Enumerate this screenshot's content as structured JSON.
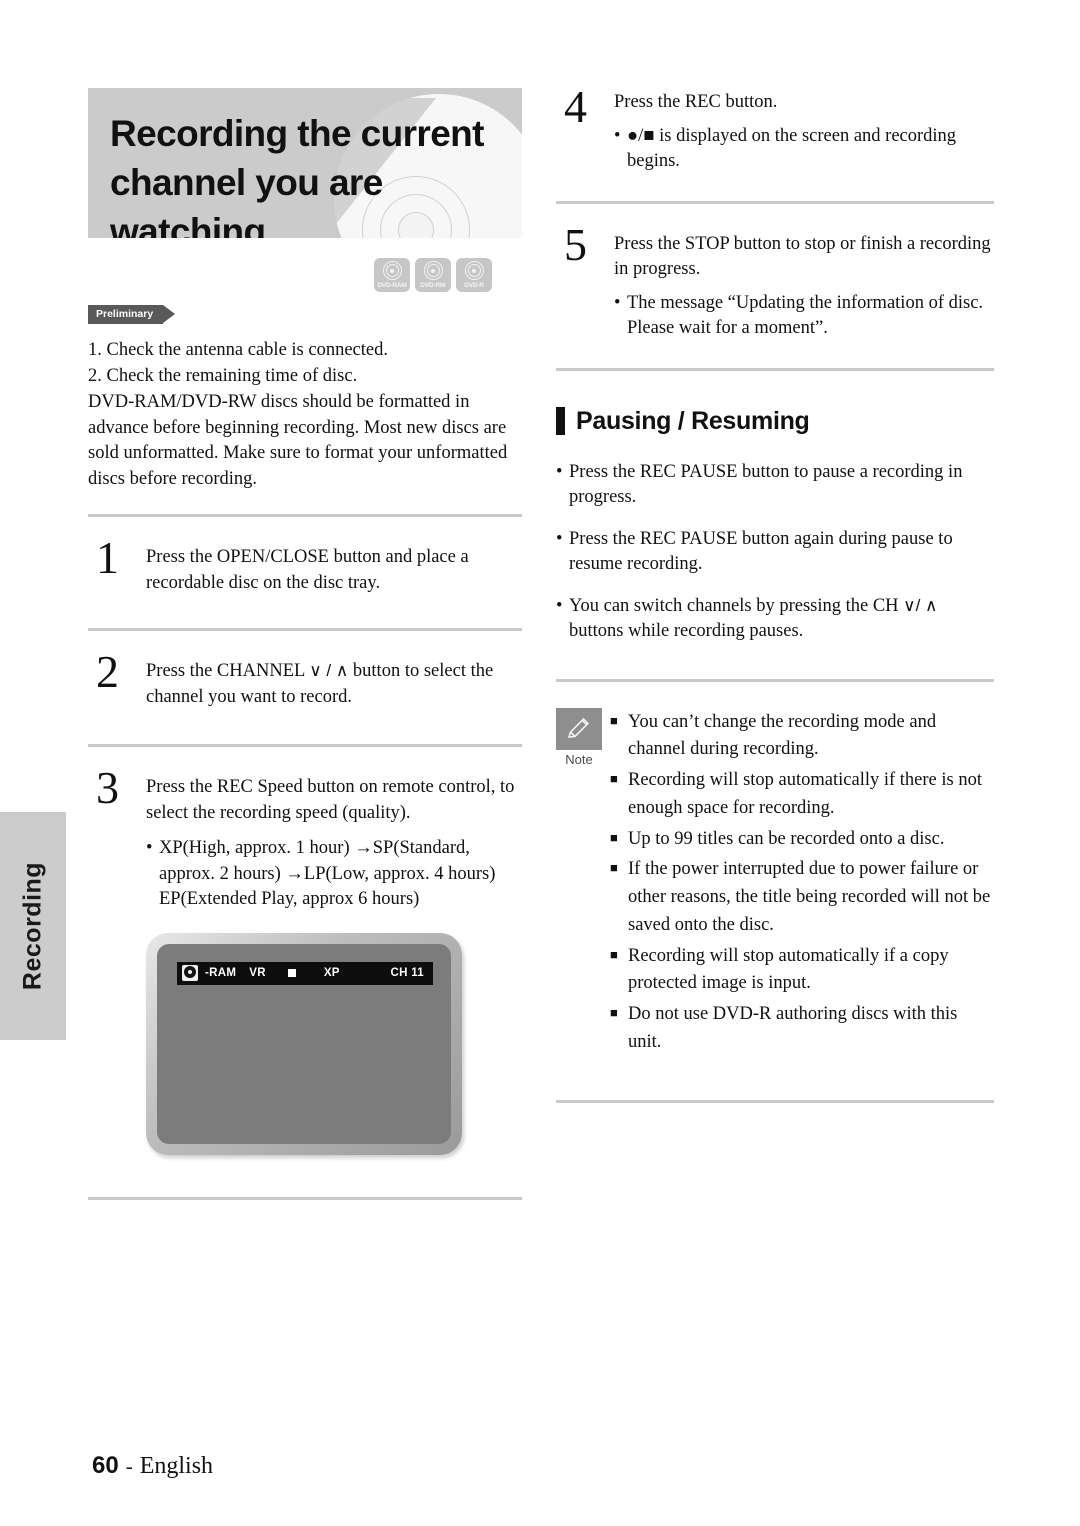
{
  "side_tab": {
    "label": "Recording"
  },
  "banner": {
    "title_line1": "Recording the current",
    "title_line2": "channel you are watching"
  },
  "disc_badges": [
    {
      "label": "DVD-RAM",
      "icon": "disc-icon"
    },
    {
      "label": "DVD-RW",
      "icon": "disc-icon"
    },
    {
      "label": "DVD-R",
      "icon": "disc-icon"
    }
  ],
  "preliminary_flag": {
    "label": "Preliminary"
  },
  "intro": {
    "line1": "1. Check the antenna cable is connected.",
    "line2": "2. Check the remaining time of disc.",
    "paragraph": "DVD-RAM/DVD-RW discs should be formatted in advance before beginning recording. Most new discs are sold unformatted. Make sure to format your unformatted discs before recording."
  },
  "steps": [
    {
      "number": "1",
      "text": "Press the OPEN/CLOSE button and place a recordable disc on the disc tray.",
      "bullets": []
    },
    {
      "number": "2",
      "text_before": "Press the CHANNEL ",
      "arrows": "∨ / ∧",
      "text_after": " button to select the channel you want to record.",
      "bullets": []
    },
    {
      "number": "3",
      "text": "Press the REC Speed button on remote control, to select the recording speed (quality).",
      "bullets": [
        "XP(High, approx. 1 hour) →SP(Standard, approx. 2 hours) →LP(Low, approx. 4 hours) EP(Extended Play, approx 6 hours)"
      ]
    },
    {
      "number": "4",
      "text": "Press the REC button.",
      "bullets": [
        "●/■ is displayed on the screen and recording begins."
      ]
    },
    {
      "number": "5",
      "text": "Press the STOP button to stop or finish a recording in progress.",
      "bullets": [
        "The message “Updating  the information of disc. Please wait for a moment”."
      ]
    }
  ],
  "tv_figure": {
    "osd": {
      "disc_icon": "dvd-ram-disc-icon",
      "disc_type": "-RAM",
      "format": "VR",
      "status_icon": "stop-square-icon",
      "rec_speed": "XP",
      "channel": "CH 11"
    }
  },
  "pausing_section": {
    "title": "Pausing / Resuming",
    "bullets": [
      {
        "text": "Press the REC PAUSE button to pause a recording in progress."
      },
      {
        "text": "Press the REC PAUSE button again during pause to resume recording."
      },
      {
        "text_before": "You can switch channels by pressing the CH  ",
        "arrows": "∨/ ∧",
        "text_after": " buttons while recording pauses."
      }
    ]
  },
  "note_block": {
    "icon": "pencil-note-icon",
    "label": "Note",
    "items": [
      "You can’t change the recording mode and channel during recording.",
      "Recording will stop automatically if there is not enough space for recording.",
      "Up to 99 titles can be recorded onto a disc.",
      "If the power interrupted due to power failure or other reasons, the title being recorded will not be saved onto the disc.",
      "Recording will stop automatically if a copy protected image is input.",
      "Do not use DVD-R authoring discs with this unit."
    ]
  },
  "footer": {
    "page_number": "60",
    "separator": "-",
    "language": "English"
  },
  "colors": {
    "banner_bg": "#cbcbcb",
    "side_tab_bg": "#cccccc",
    "separator": "#c9c9c9",
    "note_icon_bg": "#8e8e8e",
    "prelim_bg": "#595959",
    "osd_bg": "#0d0d0d",
    "tv_screen": "#7c7c7c"
  }
}
